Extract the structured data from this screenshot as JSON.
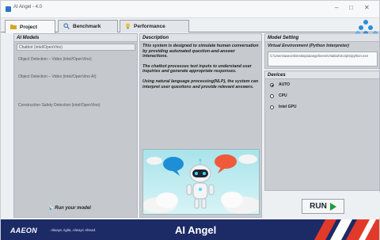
{
  "window": {
    "title": "AI Angel - 4.0"
  },
  "tabs": [
    {
      "label": "Project",
      "icon": "folder-icon"
    },
    {
      "label": "Benchmark",
      "icon": "magnifier-icon"
    },
    {
      "label": "Performance",
      "icon": "lightbulb-icon"
    }
  ],
  "logo": {
    "label": "AI Angel"
  },
  "models_panel": {
    "header": "AI Models",
    "items": [
      "Chatbot (intel/OpenVino)",
      "Object Detection – Video (intel/OpenVino)",
      "Object Detection – Video (intel/OpenVino AI)",
      "Construction Safety Detection (intel/OpenVino)"
    ],
    "run_label": "Run your model"
  },
  "description_panel": {
    "header": "Description",
    "paragraphs": [
      "This system is designed to simulate human conversation by providing automated question-and-answer interactions.",
      "The chatbot processes text inputs to understand user inquiries and generate appropriate responses.",
      "Using natural language processing(NLP), the system can interpret user questions and provide relevant answers."
    ]
  },
  "settings_panel": {
    "header": "Model Setting",
    "venv_label": "Virtual Environment (Python Interpreter)",
    "venv_path": "C:\\Users\\aaeon\\Desktop\\aiangel\\venv\\chatbot\\Scripts\\python.exe"
  },
  "devices_panel": {
    "header": "Devices",
    "options": [
      {
        "label": "AUTO",
        "selected": true
      },
      {
        "label": "CPU",
        "selected": false
      },
      {
        "label": "Intel GPU",
        "selected": false
      }
    ]
  },
  "run_button": {
    "label": "RUN"
  },
  "footer": {
    "brand": "AAEON",
    "tagline": "Always Agile, Always Ahead.",
    "title": "AI Angel"
  },
  "colors": {
    "footer_bg": "#1c2a66",
    "accent_red": "#e23a2a",
    "run_green": "#1f9d3a",
    "logo_blue": "#2a8ee0"
  }
}
